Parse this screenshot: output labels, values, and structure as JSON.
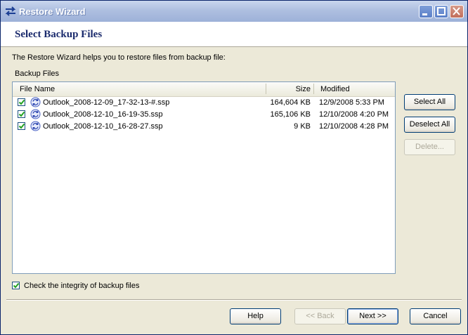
{
  "window": {
    "title": "Restore Wizard"
  },
  "header": {
    "title": "Select Backup Files"
  },
  "intro": "The Restore Wizard helps you to restore files from backup file:",
  "group_label": "Backup Files",
  "columns": {
    "name": "File Name",
    "size": "Size",
    "modified": "Modified"
  },
  "files": [
    {
      "name": "Outlook_2008-12-09_17-32-13-#.ssp",
      "size": "164,604 KB",
      "modified": "12/9/2008 5:33 PM",
      "checked": true
    },
    {
      "name": "Outlook_2008-12-10_16-19-35.ssp",
      "size": "165,106 KB",
      "modified": "12/10/2008 4:20 PM",
      "checked": true
    },
    {
      "name": "Outlook_2008-12-10_16-28-27.ssp",
      "size": "9 KB",
      "modified": "12/10/2008 4:28 PM",
      "checked": true
    }
  ],
  "side_buttons": {
    "select_all": "Select All",
    "deselect_all": "Deselect All",
    "delete": "Delete..."
  },
  "integrity": {
    "label": "Check the integrity of backup files",
    "checked": true
  },
  "footer": {
    "help": "Help",
    "back": "<< Back",
    "next": "Next >>",
    "cancel": "Cancel"
  },
  "icons": {
    "title": "swap-arrows-icon",
    "file": "refresh-icon",
    "check": "checkmark-icon"
  },
  "colors": {
    "header_title": "#1a2a6c",
    "title_bar": "#aebfe0",
    "check": "#21a121"
  }
}
